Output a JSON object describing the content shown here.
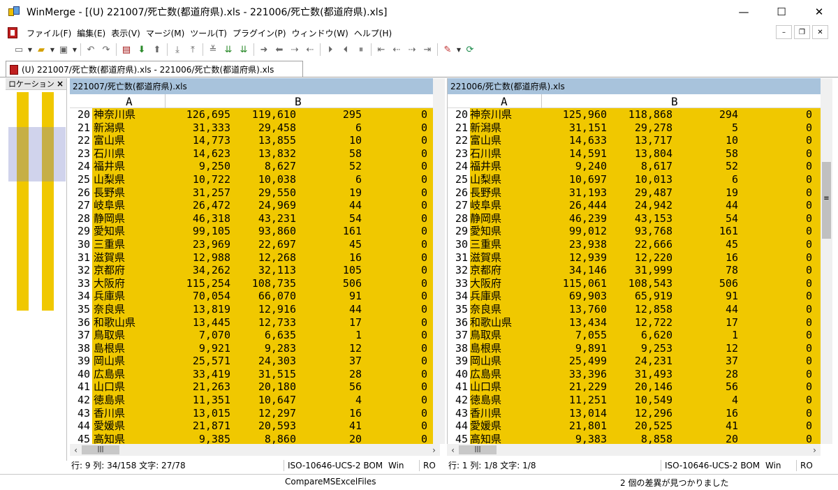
{
  "window": {
    "title": "WinMerge - [(U) 221007/死亡数(都道府県).xls - 221006/死亡数(都道府県).xls]",
    "minimize_glyph": "—",
    "maximize_glyph": "☐",
    "close_glyph": "✕"
  },
  "menu": {
    "items": [
      "ファイル(F)",
      "編集(E)",
      "表示(V)",
      "マージ(M)",
      "ツール(T)",
      "プラグイン(P)",
      "ウィンドウ(W)",
      "ヘルプ(H)"
    ],
    "mdi_minimize": "–",
    "mdi_restore": "❐",
    "mdi_close": "✕"
  },
  "tab": {
    "label": "(U) 221007/死亡数(都道府県).xls - 221006/死亡数(都道府県).xls"
  },
  "location_pane": {
    "title": "ロケーション /",
    "close_glyph": "×"
  },
  "left_pane": {
    "title": "221007/死亡数(都道府県).xls",
    "col_a": "A",
    "col_b": "B",
    "rows": [
      {
        "n": "20",
        "name": "神奈川県",
        "c1": "126,695",
        "c2": "119,610",
        "c3": "295",
        "c4": "0"
      },
      {
        "n": "21",
        "name": "新潟県",
        "c1": "31,333",
        "c2": "29,458",
        "c3": "6",
        "c4": "0"
      },
      {
        "n": "22",
        "name": "富山県",
        "c1": "14,773",
        "c2": "13,855",
        "c3": "10",
        "c4": "0"
      },
      {
        "n": "23",
        "name": "石川県",
        "c1": "14,623",
        "c2": "13,832",
        "c3": "58",
        "c4": "0"
      },
      {
        "n": "24",
        "name": "福井県",
        "c1": "9,250",
        "c2": "8,627",
        "c3": "52",
        "c4": "0"
      },
      {
        "n": "25",
        "name": "山梨県",
        "c1": "10,722",
        "c2": "10,038",
        "c3": "6",
        "c4": "0"
      },
      {
        "n": "26",
        "name": "長野県",
        "c1": "31,257",
        "c2": "29,550",
        "c3": "19",
        "c4": "0"
      },
      {
        "n": "27",
        "name": "岐阜県",
        "c1": "26,472",
        "c2": "24,969",
        "c3": "44",
        "c4": "0"
      },
      {
        "n": "28",
        "name": "静岡県",
        "c1": "46,318",
        "c2": "43,231",
        "c3": "54",
        "c4": "0"
      },
      {
        "n": "29",
        "name": "愛知県",
        "c1": "99,105",
        "c2": "93,860",
        "c3": "161",
        "c4": "0"
      },
      {
        "n": "30",
        "name": "三重県",
        "c1": "23,969",
        "c2": "22,697",
        "c3": "45",
        "c4": "0"
      },
      {
        "n": "31",
        "name": "滋賀県",
        "c1": "12,988",
        "c2": "12,268",
        "c3": "16",
        "c4": "0"
      },
      {
        "n": "32",
        "name": "京都府",
        "c1": "34,262",
        "c2": "32,113",
        "c3": "105",
        "c4": "0"
      },
      {
        "n": "33",
        "name": "大阪府",
        "c1": "115,254",
        "c2": "108,735",
        "c3": "506",
        "c4": "0"
      },
      {
        "n": "34",
        "name": "兵庫県",
        "c1": "70,054",
        "c2": "66,070",
        "c3": "91",
        "c4": "0"
      },
      {
        "n": "35",
        "name": "奈良県",
        "c1": "13,819",
        "c2": "12,916",
        "c3": "44",
        "c4": "0"
      },
      {
        "n": "36",
        "name": "和歌山県",
        "c1": "13,445",
        "c2": "12,733",
        "c3": "17",
        "c4": "0"
      },
      {
        "n": "37",
        "name": "鳥取県",
        "c1": "7,070",
        "c2": "6,635",
        "c3": "1",
        "c4": "0"
      },
      {
        "n": "38",
        "name": "島根県",
        "c1": "9,921",
        "c2": "9,283",
        "c3": "12",
        "c4": "0"
      },
      {
        "n": "39",
        "name": "岡山県",
        "c1": "25,571",
        "c2": "24,303",
        "c3": "37",
        "c4": "0"
      },
      {
        "n": "40",
        "name": "広島県",
        "c1": "33,419",
        "c2": "31,515",
        "c3": "28",
        "c4": "0"
      },
      {
        "n": "41",
        "name": "山口県",
        "c1": "21,263",
        "c2": "20,180",
        "c3": "56",
        "c4": "0"
      },
      {
        "n": "42",
        "name": "徳島県",
        "c1": "11,351",
        "c2": "10,647",
        "c3": "4",
        "c4": "0"
      },
      {
        "n": "43",
        "name": "香川県",
        "c1": "13,015",
        "c2": "12,297",
        "c3": "16",
        "c4": "0"
      },
      {
        "n": "44",
        "name": "愛媛県",
        "c1": "21,871",
        "c2": "20,593",
        "c3": "41",
        "c4": "0"
      },
      {
        "n": "45",
        "name": "高知県",
        "c1": "9,385",
        "c2": "8,860",
        "c3": "20",
        "c4": "0"
      }
    ]
  },
  "right_pane": {
    "title": "221006/死亡数(都道府県).xls",
    "col_a": "A",
    "col_b": "B",
    "rows": [
      {
        "n": "20",
        "name": "神奈川県",
        "c1": "125,960",
        "c2": "118,868",
        "c3": "294",
        "c4": "0"
      },
      {
        "n": "21",
        "name": "新潟県",
        "c1": "31,151",
        "c2": "29,278",
        "c3": "5",
        "c4": "0"
      },
      {
        "n": "22",
        "name": "富山県",
        "c1": "14,633",
        "c2": "13,717",
        "c3": "10",
        "c4": "0"
      },
      {
        "n": "23",
        "name": "石川県",
        "c1": "14,591",
        "c2": "13,804",
        "c3": "58",
        "c4": "0"
      },
      {
        "n": "24",
        "name": "福井県",
        "c1": "9,240",
        "c2": "8,617",
        "c3": "52",
        "c4": "0"
      },
      {
        "n": "25",
        "name": "山梨県",
        "c1": "10,697",
        "c2": "10,013",
        "c3": "6",
        "c4": "0"
      },
      {
        "n": "26",
        "name": "長野県",
        "c1": "31,193",
        "c2": "29,487",
        "c3": "19",
        "c4": "0"
      },
      {
        "n": "27",
        "name": "岐阜県",
        "c1": "26,444",
        "c2": "24,942",
        "c3": "44",
        "c4": "0"
      },
      {
        "n": "28",
        "name": "静岡県",
        "c1": "46,239",
        "c2": "43,153",
        "c3": "54",
        "c4": "0"
      },
      {
        "n": "29",
        "name": "愛知県",
        "c1": "99,012",
        "c2": "93,768",
        "c3": "161",
        "c4": "0"
      },
      {
        "n": "30",
        "name": "三重県",
        "c1": "23,938",
        "c2": "22,666",
        "c3": "45",
        "c4": "0"
      },
      {
        "n": "31",
        "name": "滋賀県",
        "c1": "12,939",
        "c2": "12,220",
        "c3": "16",
        "c4": "0"
      },
      {
        "n": "32",
        "name": "京都府",
        "c1": "34,146",
        "c2": "31,999",
        "c3": "78",
        "c4": "0"
      },
      {
        "n": "33",
        "name": "大阪府",
        "c1": "115,061",
        "c2": "108,543",
        "c3": "506",
        "c4": "0"
      },
      {
        "n": "34",
        "name": "兵庫県",
        "c1": "69,903",
        "c2": "65,919",
        "c3": "91",
        "c4": "0"
      },
      {
        "n": "35",
        "name": "奈良県",
        "c1": "13,760",
        "c2": "12,858",
        "c3": "44",
        "c4": "0"
      },
      {
        "n": "36",
        "name": "和歌山県",
        "c1": "13,434",
        "c2": "12,722",
        "c3": "17",
        "c4": "0"
      },
      {
        "n": "37",
        "name": "鳥取県",
        "c1": "7,055",
        "c2": "6,620",
        "c3": "1",
        "c4": "0"
      },
      {
        "n": "38",
        "name": "島根県",
        "c1": "9,891",
        "c2": "9,253",
        "c3": "12",
        "c4": "0"
      },
      {
        "n": "39",
        "name": "岡山県",
        "c1": "25,499",
        "c2": "24,231",
        "c3": "37",
        "c4": "0"
      },
      {
        "n": "40",
        "name": "広島県",
        "c1": "33,396",
        "c2": "31,493",
        "c3": "28",
        "c4": "0"
      },
      {
        "n": "41",
        "name": "山口県",
        "c1": "21,229",
        "c2": "20,146",
        "c3": "56",
        "c4": "0"
      },
      {
        "n": "42",
        "name": "徳島県",
        "c1": "11,251",
        "c2": "10,549",
        "c3": "4",
        "c4": "0"
      },
      {
        "n": "43",
        "name": "香川県",
        "c1": "13,014",
        "c2": "12,296",
        "c3": "16",
        "c4": "0"
      },
      {
        "n": "44",
        "name": "愛媛県",
        "c1": "21,801",
        "c2": "20,525",
        "c3": "41",
        "c4": "0"
      },
      {
        "n": "45",
        "name": "高知県",
        "c1": "9,383",
        "c2": "8,858",
        "c3": "20",
        "c4": "0"
      }
    ]
  },
  "status": {
    "left": {
      "pos": "行: 9  列: 34/158  文字: 27/78",
      "enc": "ISO-10646-UCS-2 BOM",
      "eol": "Win",
      "ro": "RO"
    },
    "right": {
      "pos": "行: 1  列: 1/8  文字: 1/8",
      "enc": "ISO-10646-UCS-2 BOM",
      "eol": "Win",
      "ro": "RO"
    },
    "plugin": "CompareMSExcelFiles",
    "diffs": "2 個の差異が見つかりました"
  },
  "colors": {
    "diff_row": "#f0c800",
    "diff_highlight": "#fbeec0",
    "pane_title": "#a8c3dc",
    "location_view": "#7882c8"
  }
}
